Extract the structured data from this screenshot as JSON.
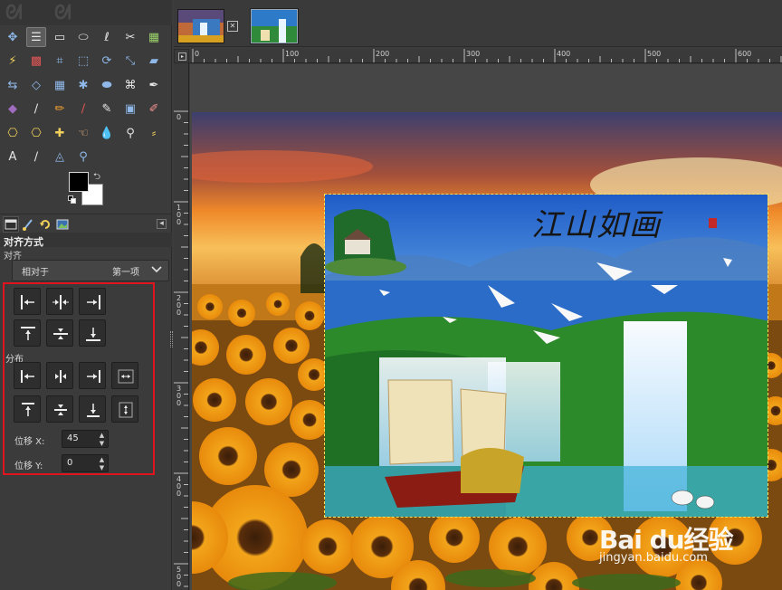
{
  "toolbox": {
    "tools": [
      {
        "name": "move-tool",
        "glyph": "✥",
        "color": "#8fb8e8"
      },
      {
        "name": "align-tool",
        "glyph": "☰",
        "color": "#e6e6e6",
        "active": true
      },
      {
        "name": "rect-select-tool",
        "glyph": "▭",
        "color": "#e6e6e6"
      },
      {
        "name": "ellipse-select-tool",
        "glyph": "⬭",
        "color": "#e6e6e6"
      },
      {
        "name": "free-select-tool",
        "glyph": "ℓ",
        "color": "#e6e6e6"
      },
      {
        "name": "scissors-select-tool",
        "glyph": "✂",
        "color": "#e6e6e6"
      },
      {
        "name": "foreground-select-tool",
        "glyph": "▦",
        "color": "#9ad06a"
      },
      {
        "name": "fuzzy-select-tool",
        "glyph": "⚡",
        "color": "#f0d05a"
      },
      {
        "name": "select-by-color-tool",
        "glyph": "▩",
        "color": "#e05555"
      },
      {
        "name": "crop-tool",
        "glyph": "⌗",
        "color": "#8fb8e8"
      },
      {
        "name": "unified-transform-tool",
        "glyph": "⬚",
        "color": "#8fb8e8"
      },
      {
        "name": "rotate-tool",
        "glyph": "⟳",
        "color": "#8fb8e8"
      },
      {
        "name": "scale-tool",
        "glyph": "⤡",
        "color": "#8fb8e8"
      },
      {
        "name": "shear-tool",
        "glyph": "▰",
        "color": "#8fb8e8"
      },
      {
        "name": "flip-tool",
        "glyph": "⇆",
        "color": "#8fb8e8"
      },
      {
        "name": "perspective-tool",
        "glyph": "◇",
        "color": "#8fb8e8"
      },
      {
        "name": "cage-transform-tool",
        "glyph": "▦",
        "color": "#8fb8e8"
      },
      {
        "name": "warp-transform-tool",
        "glyph": "✱",
        "color": "#8fb8e8"
      },
      {
        "name": "handle-transform-tool",
        "glyph": "⬬",
        "color": "#8fb8e8"
      },
      {
        "name": "n-point-deformation-tool",
        "glyph": "⌘",
        "color": "#e6e6e6"
      },
      {
        "name": "paths-tool",
        "glyph": "✒",
        "color": "#e6e6e6"
      },
      {
        "name": "bucket-fill-tool",
        "glyph": "◆",
        "color": "#a06cc0"
      },
      {
        "name": "paintbrush-tool",
        "glyph": "∕",
        "color": "#e6e6e6"
      },
      {
        "name": "pencil-tool",
        "glyph": "✏",
        "color": "#f0a030"
      },
      {
        "name": "airbrush-tool",
        "glyph": "∕",
        "color": "#e05555"
      },
      {
        "name": "ink-tool",
        "glyph": "✎",
        "color": "#e6e6e6"
      },
      {
        "name": "mypaint-brush-tool",
        "glyph": "▣",
        "color": "#8fb8e8"
      },
      {
        "name": "eraser-tool",
        "glyph": "✐",
        "color": "#f09090"
      },
      {
        "name": "clone-tool",
        "glyph": "⎔",
        "color": "#f0d05a"
      },
      {
        "name": "perspective-clone-tool",
        "glyph": "⎔",
        "color": "#f0d05a"
      },
      {
        "name": "heal-tool",
        "glyph": "✚",
        "color": "#f0d05a"
      },
      {
        "name": "smudge-tool",
        "glyph": "☜",
        "color": "#e8b080"
      },
      {
        "name": "blur-sharpen-tool",
        "glyph": "💧",
        "color": "#8fb8e8"
      },
      {
        "name": "dodge-burn-tool",
        "glyph": "⚲",
        "color": "#e6e6e6"
      },
      {
        "name": "color-picker-tool",
        "glyph": "⸗",
        "color": "#f0d05a"
      },
      {
        "name": "text-tool",
        "glyph": "A",
        "color": "#e6e6e6"
      },
      {
        "name": "color-picker-2-tool",
        "glyph": "∕",
        "color": "#e6e6e6"
      },
      {
        "name": "measure-tool",
        "glyph": "◬",
        "color": "#8fb8e8"
      },
      {
        "name": "zoom-tool",
        "glyph": "⚲",
        "color": "#8fb8e8"
      }
    ]
  },
  "tool_options": {
    "title": "对齐方式",
    "align_section": "对齐",
    "relative_to_label": "相对于",
    "relative_to_value": "第一项",
    "distribute_section": "分布",
    "offset_x_label": "位移 X:",
    "offset_x_value": "45",
    "offset_y_label": "位移 Y:",
    "offset_y_value": "0"
  },
  "rulers": {
    "h_labels": [
      "0",
      "100",
      "200",
      "300",
      "400",
      "500",
      "600"
    ],
    "v_labels": [
      "0",
      "100",
      "200",
      "300",
      "400",
      "500"
    ]
  },
  "canvas": {
    "calligraphy": "江山如画",
    "watermark_logo": "Bai du经验",
    "watermark_url": "jingyan.baidu.com"
  },
  "colors": {
    "highlight_border": "#e0141e",
    "selection_border": "#ffe45a",
    "dock_bg": "#3b3b3b"
  }
}
